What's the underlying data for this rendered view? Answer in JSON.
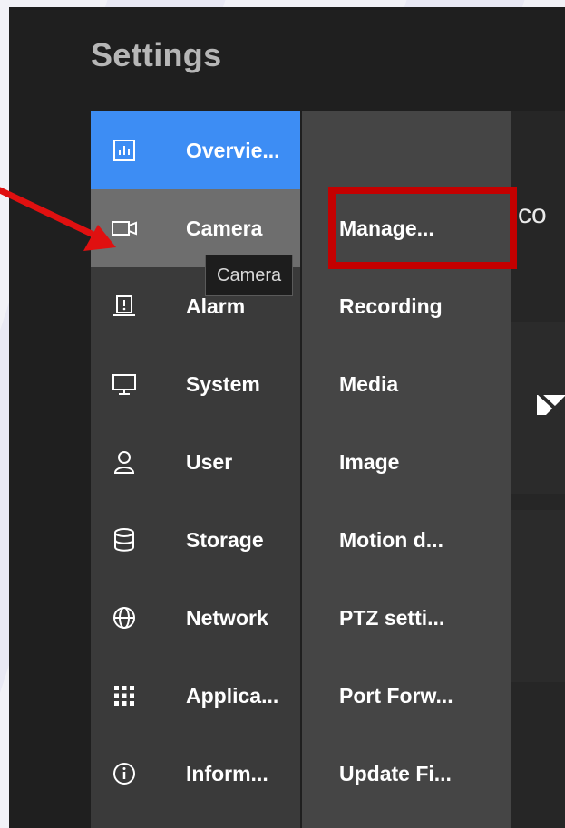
{
  "window": {
    "title": "Settings"
  },
  "nav": {
    "items": [
      {
        "label": "Overvie...",
        "icon": "chart-icon"
      },
      {
        "label": "Camera",
        "icon": "camera-icon"
      },
      {
        "label": "Alarm",
        "icon": "alarm-icon"
      },
      {
        "label": "System",
        "icon": "monitor-icon"
      },
      {
        "label": "User",
        "icon": "user-icon"
      },
      {
        "label": "Storage",
        "icon": "database-icon"
      },
      {
        "label": "Network",
        "icon": "globe-icon"
      },
      {
        "label": "Applica...",
        "icon": "grid-icon"
      },
      {
        "label": "Inform...",
        "icon": "info-icon"
      }
    ],
    "active": "Overvie...",
    "hovered": "Camera"
  },
  "submenu": {
    "items": [
      {
        "label": "Manage..."
      },
      {
        "label": "Recording"
      },
      {
        "label": "Media"
      },
      {
        "label": "Image"
      },
      {
        "label": "Motion d..."
      },
      {
        "label": "PTZ setti..."
      },
      {
        "label": "Port Forw..."
      },
      {
        "label": "Update Fi..."
      }
    ]
  },
  "tooltip": {
    "text": "Camera"
  },
  "right": {
    "partial_text": "co"
  },
  "colors": {
    "accent": "#3d8df4",
    "hover": "#6e6e6e",
    "annotation": "#c40000",
    "arrow": "#e01010"
  }
}
